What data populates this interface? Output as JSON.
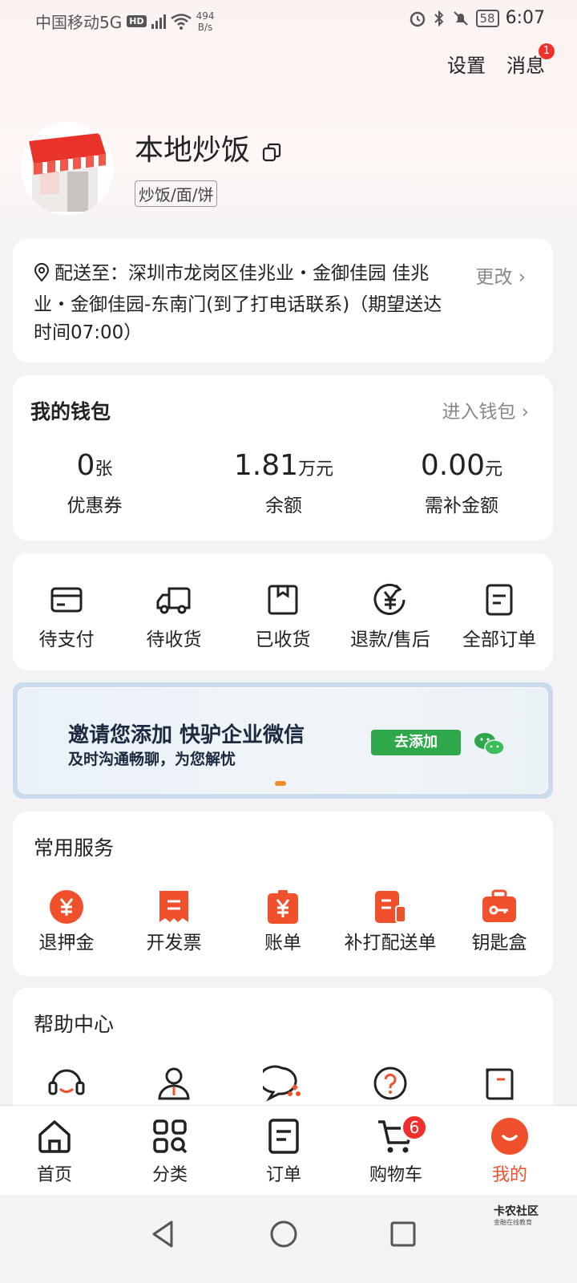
{
  "status_bar": {
    "carrier": "中国移动5G",
    "hd": "HD",
    "net_speed_value": "494",
    "net_speed_unit": "B/s",
    "battery": "58",
    "time": "6:07"
  },
  "header": {
    "settings_label": "设置",
    "messages_label": "消息",
    "messages_badge": "1"
  },
  "profile": {
    "shop_name": "本地炒饭",
    "category": "炒饭/面/饼"
  },
  "address": {
    "text": "配送至：深圳市龙岗区佳兆业・金御佳园 佳兆业・金御佳园-东南门(到了打电话联系)（期望送达时间07:00）",
    "change_label": "更改 ›"
  },
  "wallet": {
    "title": "我的钱包",
    "enter_label": "进入钱包 ›",
    "items": [
      {
        "value": "0",
        "unit": "张",
        "label": "优惠券"
      },
      {
        "value": "1.81",
        "unit": "万元",
        "label": "余额"
      },
      {
        "value": "0.00",
        "unit": "元",
        "label": "需补金额"
      }
    ]
  },
  "orders": {
    "items": [
      {
        "label": "待支付",
        "icon": "card-icon"
      },
      {
        "label": "待收货",
        "icon": "truck-icon"
      },
      {
        "label": "已收货",
        "icon": "box-icon"
      },
      {
        "label": "退款/售后",
        "icon": "refund-icon"
      },
      {
        "label": "全部订单",
        "icon": "order-list-icon"
      }
    ]
  },
  "banner": {
    "title": "邀请您添加 快驴企业微信",
    "subtitle": "及时沟通畅聊，为您解忧",
    "button_label": "去添加",
    "accent": "#2ea84a"
  },
  "services": {
    "title": "常用服务",
    "accent": "#f0502c",
    "items": [
      {
        "label": "退押金",
        "icon": "yuan-coin-icon"
      },
      {
        "label": "开发票",
        "icon": "invoice-icon"
      },
      {
        "label": "账单",
        "icon": "bill-icon"
      },
      {
        "label": "补打配送单",
        "icon": "print-slip-icon"
      },
      {
        "label": "钥匙盒",
        "icon": "key-box-icon"
      }
    ]
  },
  "help": {
    "title": "帮助中心",
    "items": [
      {
        "icon": "customer-service-icon"
      },
      {
        "icon": "sales-manager-icon"
      },
      {
        "icon": "sales-chat-icon"
      },
      {
        "icon": "question-icon"
      },
      {
        "icon": "guide-icon"
      }
    ]
  },
  "tabs": {
    "active": "我的",
    "active_color": "#f0502c",
    "items": [
      {
        "label": "首页",
        "icon": "home-icon"
      },
      {
        "label": "分类",
        "icon": "category-icon"
      },
      {
        "label": "订单",
        "icon": "order-icon"
      },
      {
        "label": "购物车",
        "icon": "cart-icon",
        "badge": "6"
      },
      {
        "label": "我的",
        "icon": "profile-icon"
      }
    ]
  },
  "watermark": {
    "title": "卡农社区",
    "subtitle": "金融在线教育"
  }
}
